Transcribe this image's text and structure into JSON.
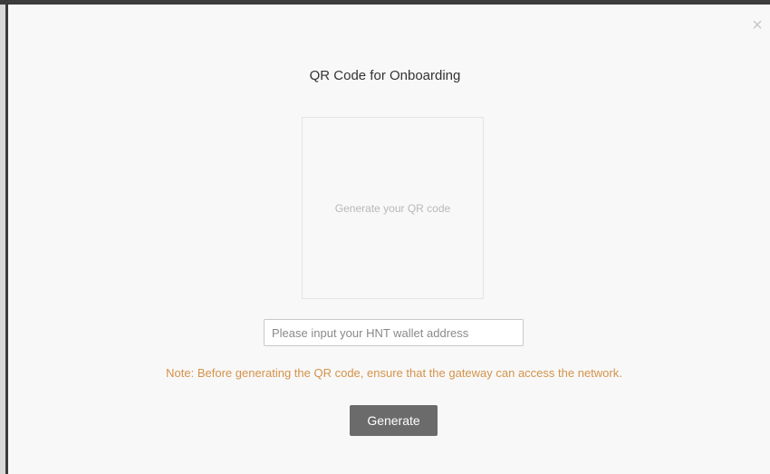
{
  "modal": {
    "close_symbol": "×",
    "title": "QR Code for Onboarding",
    "qr_placeholder": "Generate your QR code",
    "wallet_input": {
      "placeholder": "Please input your HNT wallet address",
      "value": ""
    },
    "note": "Note: Before generating the QR code, ensure that the gateway can access the network.",
    "generate_label": "Generate"
  },
  "colors": {
    "note_text": "#d4934a",
    "button_bg": "#6b6b6b",
    "modal_bg": "#f8f8f8"
  }
}
